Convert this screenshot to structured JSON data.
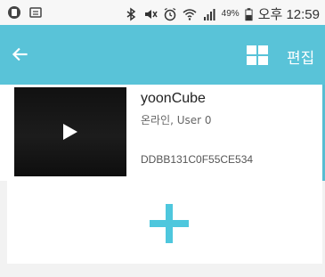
{
  "status_bar": {
    "battery_percent": "49%",
    "time": "오후 12:59",
    "icons": [
      "notification-icon",
      "screenshot-icon",
      "bluetooth-icon",
      "mute-icon",
      "alarm-icon",
      "wifi-icon",
      "signal-icon",
      "battery-icon"
    ]
  },
  "app_bar": {
    "back_icon": "back-arrow-icon",
    "grid_icon": "grid-view-icon",
    "edit_label": "편집"
  },
  "devices": [
    {
      "name": "yoonCube",
      "status": "온라인, User 0",
      "id": "DDBB131C0F55CE534",
      "thumbnail_icon": "play-icon"
    }
  ],
  "add_button": {
    "icon": "add-icon"
  },
  "colors": {
    "app_bar": "#59c3d8",
    "accent": "#58bdd2",
    "add_icon": "#4ec7dd"
  }
}
